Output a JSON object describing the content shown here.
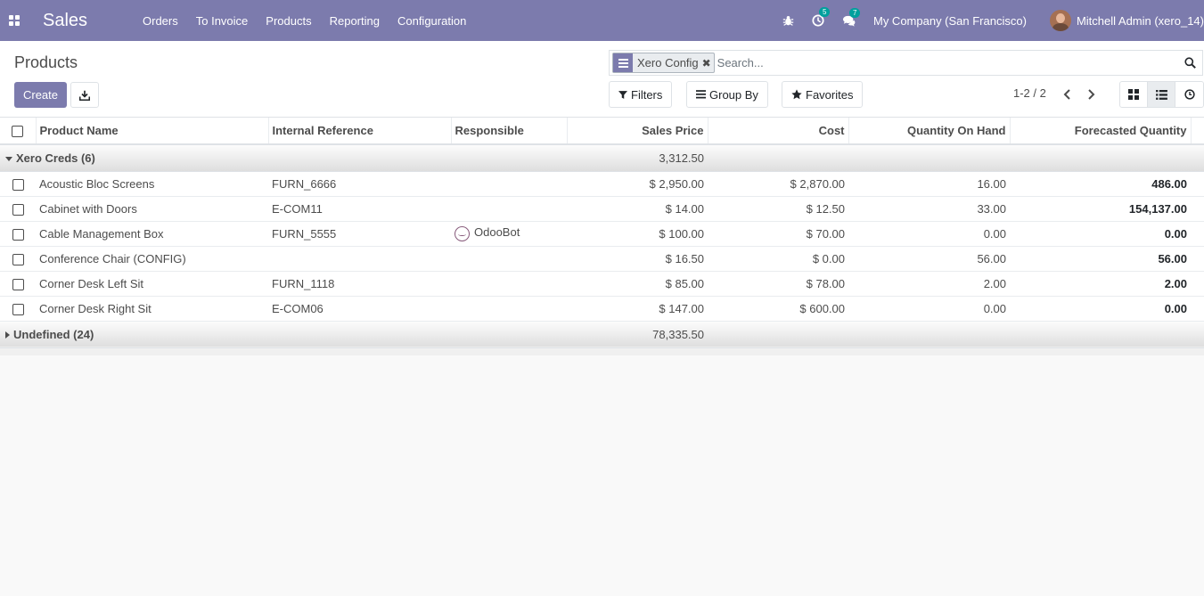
{
  "navbar": {
    "app_name": "Sales",
    "menu": [
      "Orders",
      "To Invoice",
      "Products",
      "Reporting",
      "Configuration"
    ],
    "activity_count": "5",
    "message_count": "7",
    "company": "My Company (San Francisco)",
    "user": "Mitchell Admin (xero_14)",
    "bg_color": "#7c7bad"
  },
  "control_panel": {
    "breadcrumb": "Products",
    "create_label": "Create",
    "search": {
      "facet_label": "Xero Config",
      "placeholder": "Search..."
    },
    "filters_label": "Filters",
    "group_by_label": "Group By",
    "favorites_label": "Favorites",
    "pager": "1-2 / 2"
  },
  "table": {
    "columns": [
      "Product Name",
      "Internal Reference",
      "Responsible",
      "Sales Price",
      "Cost",
      "Quantity On Hand",
      "Forecasted Quantity"
    ],
    "groups": [
      {
        "label": "Xero Creds (6)",
        "sales_total": "3,312.50",
        "rows": [
          {
            "name": "Acoustic Bloc Screens",
            "ref": "FURN_6666",
            "responsible": "",
            "price": "$ 2,950.00",
            "cost": "$ 2,870.00",
            "qty": "16.00",
            "forecast": "486.00"
          },
          {
            "name": "Cabinet with Doors",
            "ref": "E-COM11",
            "responsible": "",
            "price": "$ 14.00",
            "cost": "$ 12.50",
            "qty": "33.00",
            "forecast": "154,137.00"
          },
          {
            "name": "Cable Management Box",
            "ref": "FURN_5555",
            "responsible": "OdooBot",
            "price": "$ 100.00",
            "cost": "$ 70.00",
            "qty": "0.00",
            "forecast": "0.00"
          },
          {
            "name": "Conference Chair (CONFIG)",
            "ref": "",
            "responsible": "",
            "price": "$ 16.50",
            "cost": "$ 0.00",
            "qty": "56.00",
            "forecast": "56.00"
          },
          {
            "name": "Corner Desk Left Sit",
            "ref": "FURN_1118",
            "responsible": "",
            "price": "$ 85.00",
            "cost": "$ 78.00",
            "qty": "2.00",
            "forecast": "2.00"
          },
          {
            "name": "Corner Desk Right Sit",
            "ref": "E-COM06",
            "responsible": "",
            "price": "$ 147.00",
            "cost": "$ 600.00",
            "qty": "0.00",
            "forecast": "0.00"
          }
        ]
      },
      {
        "label": "Undefined (24)",
        "sales_total": "78,335.50"
      }
    ]
  },
  "icons": {
    "apps": "apps-grid-icon",
    "bug": "bug-icon",
    "activity": "clock-icon",
    "messages": "chat-icon",
    "download": "download-icon",
    "search": "search-icon",
    "filter": "filter-icon",
    "group": "list-icon",
    "star": "star-icon"
  }
}
